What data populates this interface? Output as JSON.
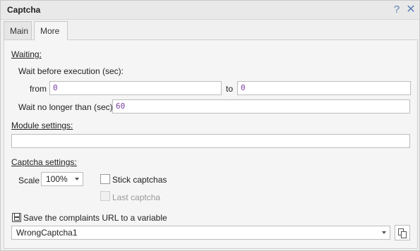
{
  "window": {
    "title": "Captcha"
  },
  "titlebar": {
    "help_glyph": "?",
    "close_glyph": "✕"
  },
  "tabs": [
    {
      "label": "Main",
      "active": false
    },
    {
      "label": "More",
      "active": true
    }
  ],
  "waiting": {
    "heading": "Waiting:",
    "before_label": "Wait before execution (sec):",
    "from_label": "from",
    "from_value": "0",
    "to_label": "to",
    "to_value": "0",
    "max_label": "Wait no longer than (sec):",
    "max_value": "60"
  },
  "module": {
    "heading": "Module settings:",
    "value": ""
  },
  "captcha": {
    "heading": "Captcha settings:",
    "scale_label": "Scale",
    "scale_value": "100%",
    "stick_label": "Stick captchas",
    "stick_checked": false,
    "last_label": "Last captcha",
    "last_checked": false,
    "last_enabled": false
  },
  "complaints": {
    "label": "Save the complaints URL to a variable",
    "variable": "WrongCaptcha1"
  }
}
